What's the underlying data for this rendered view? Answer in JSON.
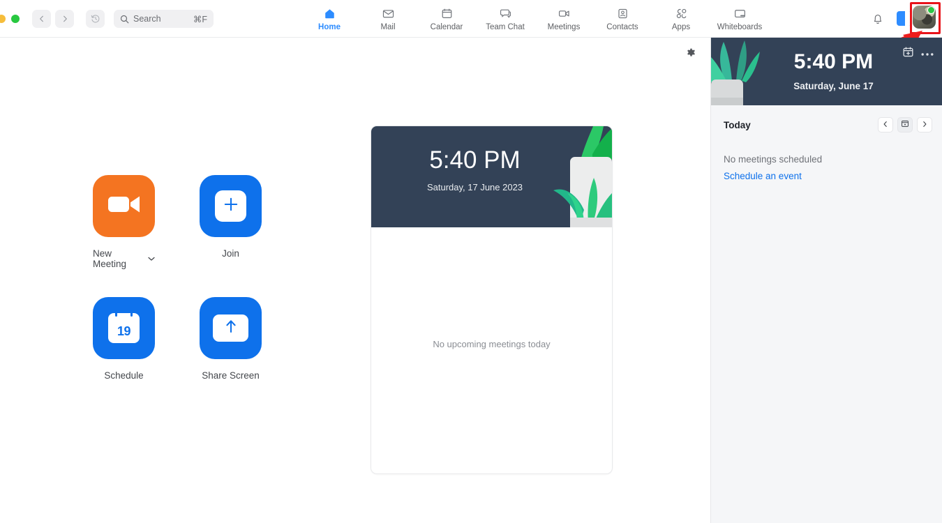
{
  "window": {
    "traffic_lights": [
      "minimize-yellow",
      "maximize-green"
    ]
  },
  "toolbar": {
    "back_icon": "chevron-left-icon",
    "forward_icon": "chevron-right-icon",
    "history_icon": "history-clock-icon",
    "search": {
      "icon": "search-icon",
      "placeholder": "Search",
      "shortcut": "⌘F"
    },
    "bell_icon": "notification-bell-icon",
    "panel_toggle_icon": "right-panel-toggle-icon",
    "avatar": {
      "name": "user-avatar",
      "status": "available",
      "status_color": "#2bc745"
    },
    "highlight_color": "#e8131a"
  },
  "nav_tabs": [
    {
      "label": "Home",
      "icon": "home-icon",
      "active": true
    },
    {
      "label": "Mail",
      "icon": "mail-envelope-icon",
      "active": false
    },
    {
      "label": "Calendar",
      "icon": "calendar-icon",
      "active": false
    },
    {
      "label": "Team Chat",
      "icon": "chat-bubbles-icon",
      "active": false
    },
    {
      "label": "Meetings",
      "icon": "video-camera-icon",
      "active": false
    },
    {
      "label": "Contacts",
      "icon": "contact-person-icon",
      "active": false
    },
    {
      "label": "Apps",
      "icon": "apps-grid-icon",
      "active": false
    },
    {
      "label": "Whiteboards",
      "icon": "whiteboard-screen-icon",
      "active": false
    }
  ],
  "main": {
    "settings_icon": "gear-icon",
    "actions": [
      {
        "label": "New Meeting",
        "icon": "video-camera-icon",
        "color": "#f47421",
        "has_dropdown": true
      },
      {
        "label": "Join",
        "icon": "plus-icon",
        "color": "#0e71eb",
        "has_dropdown": false
      },
      {
        "label": "Schedule",
        "icon": "calendar-19-icon",
        "color": "#0e71eb",
        "has_dropdown": false,
        "day_number": "19"
      },
      {
        "label": "Share Screen",
        "icon": "arrow-up-share-icon",
        "color": "#0e71eb",
        "has_dropdown": false
      }
    ],
    "card": {
      "time": "5:40 PM",
      "date": "Saturday, 17 June 2023",
      "empty_message": "No upcoming meetings today",
      "hero_color": "#334257"
    }
  },
  "right_panel": {
    "hero": {
      "time": "5:40 PM",
      "date": "Saturday, June 17",
      "add_event_icon": "calendar-plus-icon",
      "more_icon": "more-horizontal-icon",
      "hero_color": "#334257"
    },
    "today": {
      "title": "Today",
      "prev_icon": "chevron-left-icon",
      "today_icon": "calendar-today-icon",
      "next_icon": "chevron-right-icon"
    },
    "empty_state": {
      "message": "No meetings scheduled",
      "link": "Schedule an event",
      "link_color": "#0e71eb"
    }
  }
}
